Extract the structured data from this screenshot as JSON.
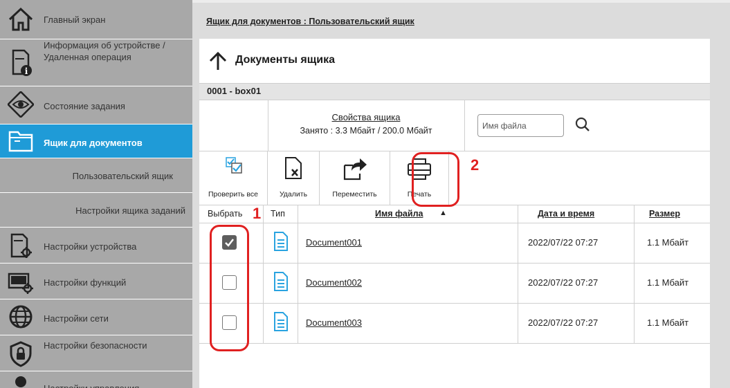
{
  "sidebar": {
    "items": [
      {
        "label": "Главный экран",
        "icon": "home-icon"
      },
      {
        "label": "Информация об устройстве / Удаленная операция",
        "icon": "device-info-icon"
      },
      {
        "label": "Состояние задания",
        "icon": "eye-icon"
      },
      {
        "label": "Ящик для документов",
        "icon": "folder-icon",
        "active": true
      },
      {
        "label": "Пользовательский ящик",
        "icon": ""
      },
      {
        "label": "Настройки ящика заданий",
        "icon": ""
      },
      {
        "label": "Настройки устройства",
        "icon": "device-settings-icon"
      },
      {
        "label": "Настройки функций",
        "icon": "function-settings-icon"
      },
      {
        "label": "Настройки сети",
        "icon": "globe-icon"
      },
      {
        "label": "Настройки безопасности",
        "icon": "shield-icon"
      },
      {
        "label": "Настройки управления",
        "icon": "user-icon"
      }
    ]
  },
  "main": {
    "breadcrumb": "Ящик для документов : Пользовательский ящик",
    "title": "Документы ящика",
    "box_name": "0001 - box01",
    "box_properties_link": "Свойства ящика",
    "usage": "Занято : 3.3 Мбайт / 200.0 Мбайт",
    "search": {
      "placeholder": "Имя файла",
      "value": ""
    }
  },
  "toolbar": {
    "check_all": "Проверить все",
    "delete": "Удалить",
    "move": "Переместить",
    "print": "Печать"
  },
  "table": {
    "headers": {
      "select": "Выбрать",
      "type": "Тип",
      "filename": "Имя файла",
      "datetime": "Дата и время",
      "size": "Размер"
    },
    "sort_indicator": "▲",
    "rows": [
      {
        "checked": true,
        "name": "Document001",
        "date": "2022/07/22 07:27",
        "size": "1.1 Мбайт"
      },
      {
        "checked": false,
        "name": "Document002",
        "date": "2022/07/22 07:27",
        "size": "1.1 Мбайт"
      },
      {
        "checked": false,
        "name": "Document003",
        "date": "2022/07/22 07:27",
        "size": "1.1 Мбайт"
      }
    ]
  },
  "callouts": {
    "one": "1",
    "two": "2"
  },
  "colors": {
    "accent": "#1f9bd7",
    "callout": "#e02020",
    "sidebar": "#a8a8a8",
    "doc_icon": "#29a3e0"
  }
}
